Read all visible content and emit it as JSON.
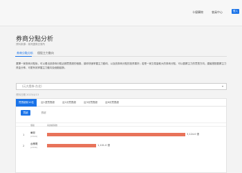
{
  "topbar": {
    "links": [
      "卡優購物",
      "會員中心"
    ],
    "login_label": "登入"
  },
  "page": {
    "title": "券商分點分析",
    "subtitle": "資料來源：臺灣證券交易所"
  },
  "tabs": [
    {
      "label": "券商分點分析"
    },
    {
      "label": "個股主力動向"
    }
  ],
  "description": "選擇一家券商分點後，可以看出該券商分點近期買賣超的個股，讓你快速掌握主力動向，以及該券商分點的投資喜好；若是一家交易量較大的券商分點，可以觀察主力的買賣方向。建議搭配觀察主力資金分佈，可更有效掌握主力動向及個股趨勢。",
  "filter": {
    "placeholder": "(元大證券-台北)"
  },
  "date_range": "資料日期 2023/4/13",
  "card": {
    "tabs": [
      "買賣超前10名",
      "近1週買賣超",
      "近1月買賣超",
      "近3月買賣超",
      "近6月買賣超"
    ],
    "subtabs": [
      "買超",
      "賣超"
    ],
    "headers": [
      "個股",
      "買賣超張數"
    ],
    "rows": [
      {
        "num": "1",
        "name": "華邦",
        "sub": "(2344)",
        "value": "3,124.0 張",
        "ratio": 1.0
      },
      {
        "num": "2",
        "name": "台積電",
        "sub": "(2330)",
        "value": "1,101.0 張",
        "ratio": 0.357
      }
    ]
  },
  "colors": {
    "accent": "#1a73e8",
    "bar": "#e8735a"
  }
}
